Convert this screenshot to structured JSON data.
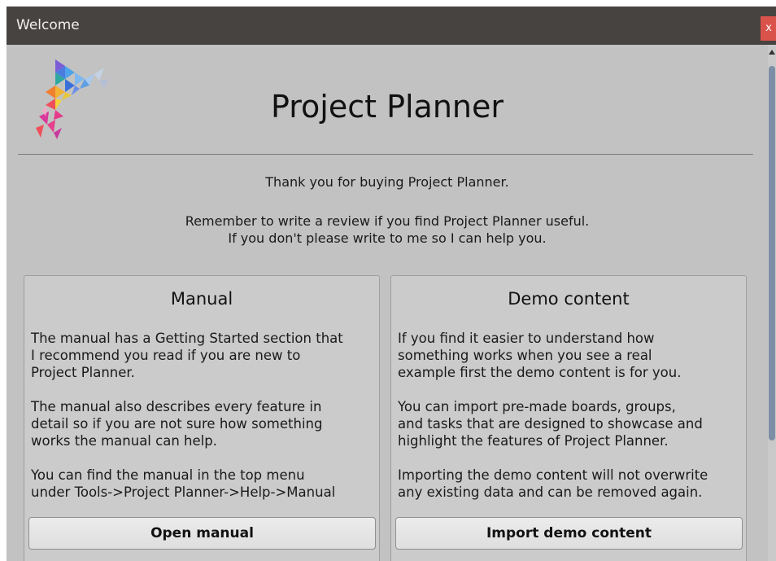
{
  "window": {
    "title": "Welcome",
    "close_label": "x"
  },
  "header": {
    "app_title": "Project Planner",
    "logo_icon": "project-planner-logo"
  },
  "intro": {
    "thanks": "Thank you for buying Project Planner.",
    "review_line1": "Remember to write a review if you find Project Planner useful.",
    "review_line2": "If you don't please write to me so I can help you."
  },
  "cards": [
    {
      "title": "Manual",
      "paragraphs": [
        "The manual has a Getting Started section that\nI recommend you read if you are new to\nProject Planner.",
        "The manual also describes every feature in\ndetail so if you are not sure how something\nworks the manual can help.",
        "You can find the manual in the top menu\nunder Tools->Project Planner->Help->Manual"
      ],
      "button_label": "Open manual"
    },
    {
      "title": "Demo content",
      "paragraphs": [
        "If you find it easier to understand how\nsomething works when you see a real\nexample first the demo content is for you.",
        "You can import pre-made boards, groups,\nand tasks that are designed to showcase and\nhighlight the features of Project Planner.",
        "Importing the demo content will not overwrite\nany existing data and can be removed again."
      ],
      "button_label": "Import demo content"
    }
  ],
  "colors": {
    "titlebar": "#474340",
    "background": "#c2c2c2",
    "close_button": "#d9534b",
    "scroll_thumb": "#7d8fa6"
  }
}
